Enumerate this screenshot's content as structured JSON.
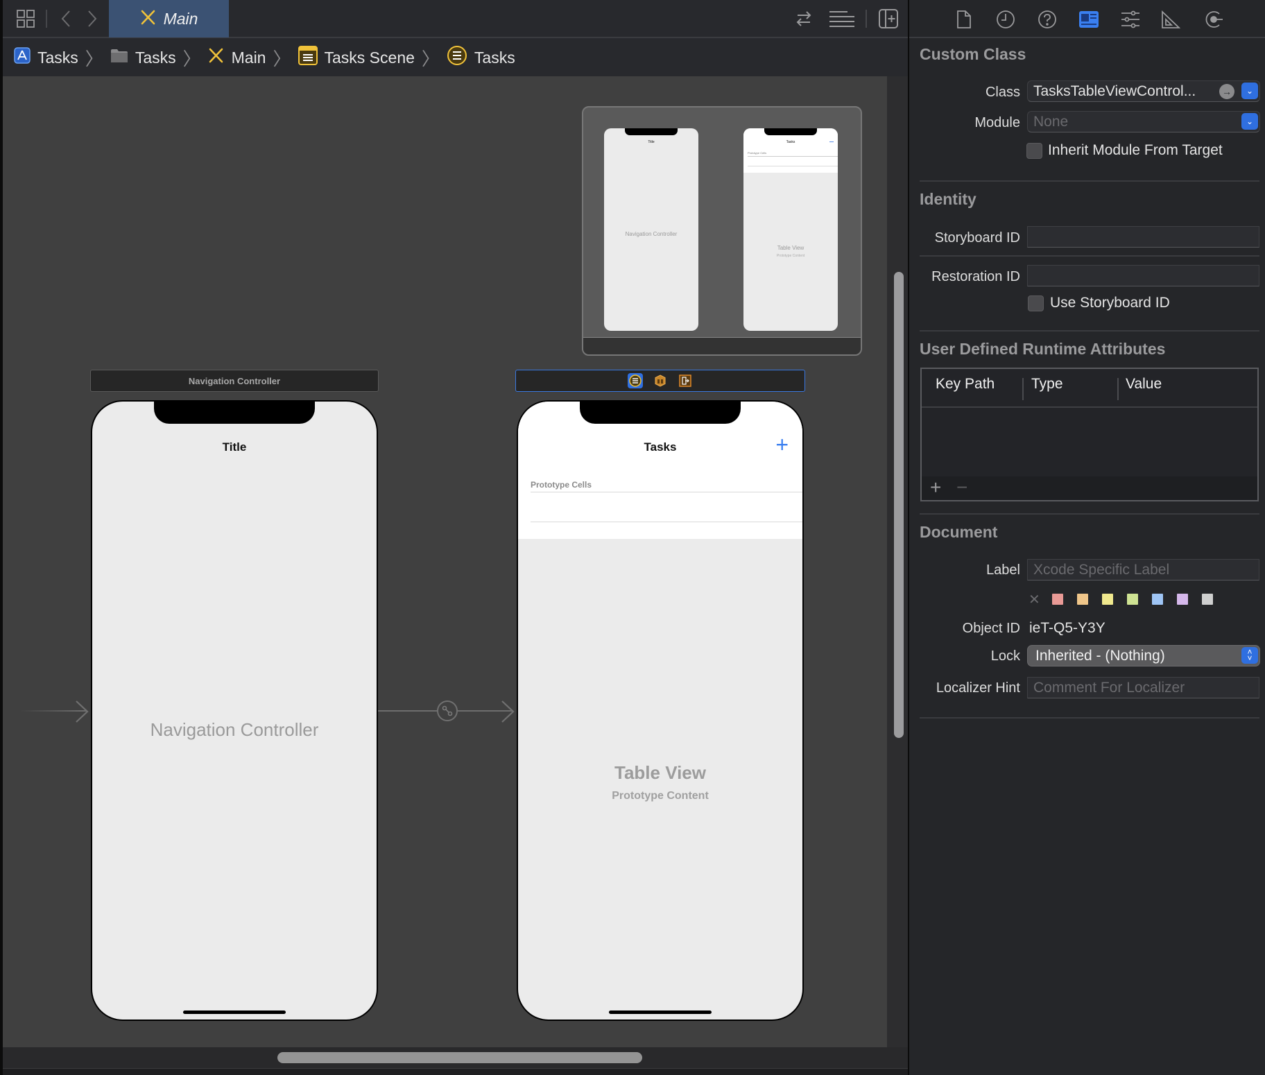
{
  "toolbar": {
    "active_tab": "Main",
    "icons": [
      "related-items-grid-icon",
      "back-chevron-icon",
      "forward-chevron-icon",
      "swap-arrows-icon",
      "editor-options-lines-icon",
      "add-editor-icon"
    ]
  },
  "breadcrumb": [
    {
      "label": "Tasks",
      "icon": "app-project-icon"
    },
    {
      "label": "Tasks",
      "icon": "folder-icon"
    },
    {
      "label": "Main",
      "icon": "storyboard-icon"
    },
    {
      "label": "Tasks Scene",
      "icon": "scene-icon"
    },
    {
      "label": "Tasks",
      "icon": "table-view-controller-icon"
    }
  ],
  "canvas": {
    "nav_scene": {
      "header": "Navigation Controller",
      "nav_title": "Title",
      "center_label": "Navigation Controller"
    },
    "table_scene": {
      "header_icons": [
        "table-view-controller-icon",
        "first-responder-icon",
        "exit-icon"
      ],
      "nav_title": "Tasks",
      "add_button": "+",
      "section_header": "Prototype Cells",
      "center_label": "Table View",
      "center_sublabel": "Prototype Content"
    },
    "minimap": {
      "left_title": "Title",
      "left_label": "Navigation Controller",
      "right_title": "Tasks",
      "right_section": "Prototype Cells",
      "right_label": "Table View",
      "right_sublabel": "Prototype Content"
    }
  },
  "inspector": {
    "tabs": [
      "file-icon",
      "history-icon",
      "help-icon",
      "identity-icon",
      "attributes-icon",
      "size-icon",
      "connections-icon"
    ],
    "active_tab": "identity-icon",
    "custom_class": {
      "title": "Custom Class",
      "class_label": "Class",
      "class_value": "TasksTableViewControl...",
      "module_label": "Module",
      "module_placeholder": "None",
      "inherit_label": "Inherit Module From Target",
      "inherit_checked": false
    },
    "identity": {
      "title": "Identity",
      "storyboard_id_label": "Storyboard ID",
      "storyboard_id_value": "",
      "restoration_id_label": "Restoration ID",
      "restoration_id_value": "",
      "use_storyboard_id_label": "Use Storyboard ID",
      "use_storyboard_id_checked": false
    },
    "udra": {
      "title": "User Defined Runtime Attributes",
      "columns": [
        "Key Path",
        "Type",
        "Value"
      ],
      "rows": [],
      "add_label": "+",
      "remove_label": "−"
    },
    "document": {
      "title": "Document",
      "label_label": "Label",
      "label_placeholder": "Xcode Specific Label",
      "label_colors": [
        "#e99a96",
        "#f0c68a",
        "#f0e88e",
        "#cfe393",
        "#9fc5f5",
        "#d6b8eb",
        "#cfcfcf"
      ],
      "object_id_label": "Object ID",
      "object_id_value": "ieT-Q5-Y3Y",
      "lock_label": "Lock",
      "lock_value": "Inherited - (Nothing)",
      "localizer_label": "Localizer Hint",
      "localizer_placeholder": "Comment For Localizer"
    }
  }
}
